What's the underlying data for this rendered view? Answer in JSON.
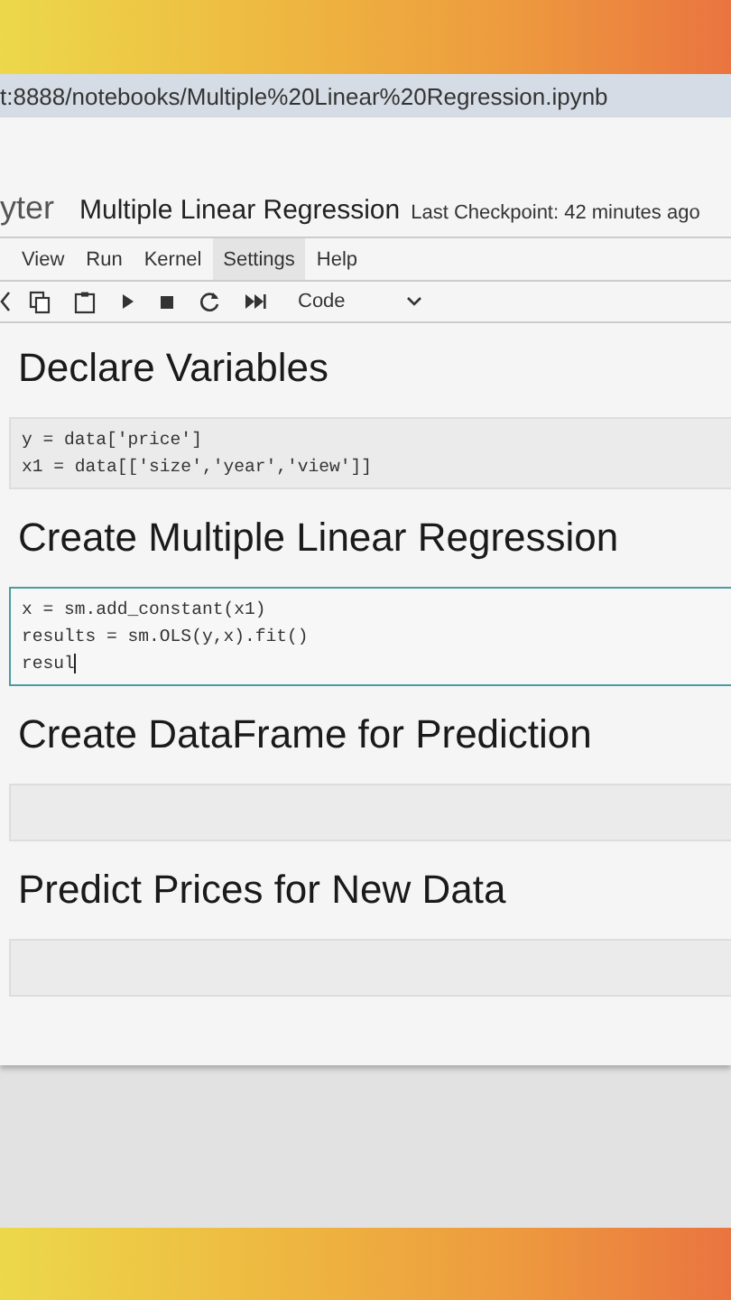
{
  "address_bar": {
    "url": "t:8888/notebooks/Multiple%20Linear%20Regression.ipynb"
  },
  "header": {
    "logo": "yter",
    "title": "Multiple Linear Regression",
    "checkpoint": "Last Checkpoint: 42 minutes ago"
  },
  "menu": [
    {
      "label": "View",
      "selected": false
    },
    {
      "label": "Run",
      "selected": false
    },
    {
      "label": "Kernel",
      "selected": false
    },
    {
      "label": "Settings",
      "selected": true
    },
    {
      "label": "Help",
      "selected": false
    }
  ],
  "toolbar": {
    "cell_type": "Code"
  },
  "cells": [
    {
      "kind": "markdown",
      "text": "Declare Variables"
    },
    {
      "kind": "code",
      "selected": false,
      "lines": [
        "y = data['price']",
        "x1 = data[['size','year','view']]"
      ]
    },
    {
      "kind": "markdown",
      "text": "Create Multiple Linear Regression"
    },
    {
      "kind": "code",
      "selected": true,
      "lines": [
        "x = sm.add_constant(x1)",
        "results = sm.OLS(y,x).fit()",
        "resul"
      ]
    },
    {
      "kind": "markdown",
      "text": "Create DataFrame for Prediction"
    },
    {
      "kind": "code",
      "selected": false
    },
    {
      "kind": "markdown",
      "text": "Predict Prices for New Data"
    },
    {
      "kind": "code",
      "selected": false
    }
  ]
}
